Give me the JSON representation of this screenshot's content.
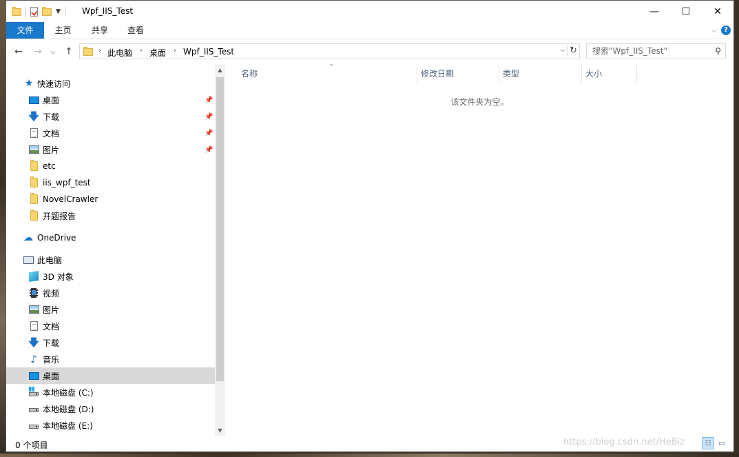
{
  "window": {
    "title": "Wpf_IIS_Test"
  },
  "window_buttons": {
    "minimize": "—",
    "maximize": "☐",
    "close": "✕"
  },
  "ribbon": {
    "tabs": [
      "文件",
      "主页",
      "共享",
      "查看"
    ],
    "expand_glyph": "⌵",
    "help_glyph": "?"
  },
  "address": {
    "crumbs": [
      "此电脑",
      "桌面",
      "Wpf_IIS_Test"
    ],
    "crumb_separator": "›",
    "dropdown_glyph": "⌵",
    "refresh_glyph": "↻"
  },
  "nav_buttons": {
    "back": "←",
    "forward": "→",
    "history": "⌵",
    "up": "↑"
  },
  "search": {
    "placeholder": "搜索\"Wpf_IIS_Test\"",
    "glyph": "⚲"
  },
  "nav_pane": {
    "quick_access": "快速访问",
    "quick_items": [
      "桌面",
      "下载",
      "文档",
      "图片",
      "etc",
      "iis_wpf_test",
      "NovelCrawler",
      "开题报告"
    ],
    "onedrive": "OneDrive",
    "this_pc": "此电脑",
    "pc_items": [
      "3D 对象",
      "视频",
      "图片",
      "文档",
      "下载",
      "音乐",
      "桌面",
      "本地磁盘 (C:)",
      "本地磁盘 (D:)",
      "本地磁盘 (E:)"
    ],
    "selected": "桌面",
    "pin_glyph": "📌",
    "scroll_up": "▲",
    "scroll_down": "▼"
  },
  "columns": [
    "名称",
    "修改日期",
    "类型",
    "大小"
  ],
  "sort_glyph": "⌃",
  "empty_message": "该文件夹为空。",
  "status": {
    "item_count": "0 个项目"
  },
  "view_glyphs": {
    "details": "☷",
    "large_icons": "▭"
  },
  "watermark": "https://blog.csdn.net/HeBiz",
  "colors": {
    "accent": "#1979ca",
    "selection": "#d9d9d9",
    "column_header": "#4c607a"
  }
}
